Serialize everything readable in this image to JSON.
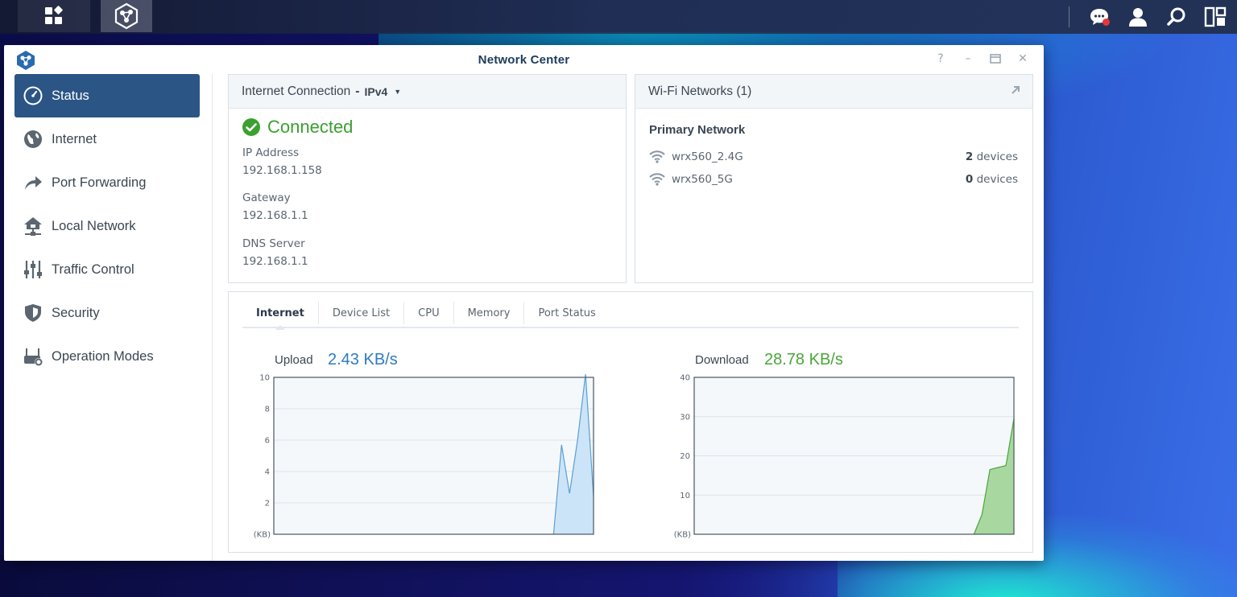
{
  "window": {
    "title": "Network Center"
  },
  "sidebar": {
    "items": [
      {
        "label": "Status",
        "icon": "gauge-icon",
        "active": true
      },
      {
        "label": "Internet",
        "icon": "globe-icon"
      },
      {
        "label": "Port Forwarding",
        "icon": "forward-arrow-icon"
      },
      {
        "label": "Local Network",
        "icon": "home-network-icon"
      },
      {
        "label": "Traffic Control",
        "icon": "sliders-icon"
      },
      {
        "label": "Security",
        "icon": "shield-icon"
      },
      {
        "label": "Operation Modes",
        "icon": "router-gear-icon"
      }
    ]
  },
  "internet_panel": {
    "title": "Internet Connection",
    "protocol": "IPv4",
    "status": "Connected",
    "ip_label": "IP Address",
    "ip_value": "192.168.1.158",
    "gateway_label": "Gateway",
    "gateway_value": "192.168.1.1",
    "dns_label": "DNS Server",
    "dns_value": "192.168.1.1"
  },
  "wifi_panel": {
    "title": "Wi-Fi Networks (1)",
    "group": "Primary Network",
    "networks": [
      {
        "name": "wrx560_2.4G",
        "count": "2",
        "unit": "devices"
      },
      {
        "name": "wrx560_5G",
        "count": "0",
        "unit": "devices"
      }
    ]
  },
  "tabs": [
    "Internet",
    "Device List",
    "CPU",
    "Memory",
    "Port Status"
  ],
  "upload": {
    "label": "Upload",
    "value": "2.43 KB/s",
    "color": "#2e7bbf"
  },
  "download": {
    "label": "Download",
    "value": "28.78 KB/s",
    "color": "#4aa63a"
  },
  "chart_data": [
    {
      "type": "area",
      "title": "Upload",
      "ylabel": "(KB)",
      "ylim": [
        0,
        10
      ],
      "yticks": [
        2,
        4,
        6,
        8,
        10
      ],
      "x": [
        0,
        1,
        2,
        3,
        4,
        5,
        6,
        7,
        8,
        9,
        10,
        11,
        12,
        13,
        14,
        15,
        16,
        17,
        18,
        19,
        20,
        21,
        22,
        23,
        24,
        25,
        26,
        27,
        28,
        29,
        30,
        31,
        32,
        33,
        34,
        35,
        36,
        37,
        38,
        39,
        40
      ],
      "values": [
        0,
        0,
        0,
        0,
        0,
        0,
        0,
        0,
        0,
        0,
        0,
        0,
        0,
        0,
        0,
        0,
        0,
        0,
        0,
        0,
        0,
        0,
        0,
        0,
        0,
        0,
        0,
        0,
        0,
        0,
        0,
        0,
        0,
        0,
        0,
        0,
        5.7,
        2.6,
        6.0,
        10.2,
        2.4
      ],
      "fill": "#cce4f7",
      "stroke": "#5a9fd4"
    },
    {
      "type": "area",
      "title": "Download",
      "ylabel": "(KB)",
      "ylim": [
        0,
        40
      ],
      "yticks": [
        10,
        20,
        30,
        40
      ],
      "x": [
        0,
        1,
        2,
        3,
        4,
        5,
        6,
        7,
        8,
        9,
        10,
        11,
        12,
        13,
        14,
        15,
        16,
        17,
        18,
        19,
        20,
        21,
        22,
        23,
        24,
        25,
        26,
        27,
        28,
        29,
        30,
        31,
        32,
        33,
        34,
        35,
        36,
        37,
        38,
        39,
        40
      ],
      "values": [
        0,
        0,
        0,
        0,
        0,
        0,
        0,
        0,
        0,
        0,
        0,
        0,
        0,
        0,
        0,
        0,
        0,
        0,
        0,
        0,
        0,
        0,
        0,
        0,
        0,
        0,
        0,
        0,
        0,
        0,
        0,
        0,
        0,
        0,
        0,
        0,
        5,
        16.5,
        17,
        17.5,
        29.5
      ],
      "fill": "#a8d8a0",
      "stroke": "#4aa63a"
    }
  ]
}
